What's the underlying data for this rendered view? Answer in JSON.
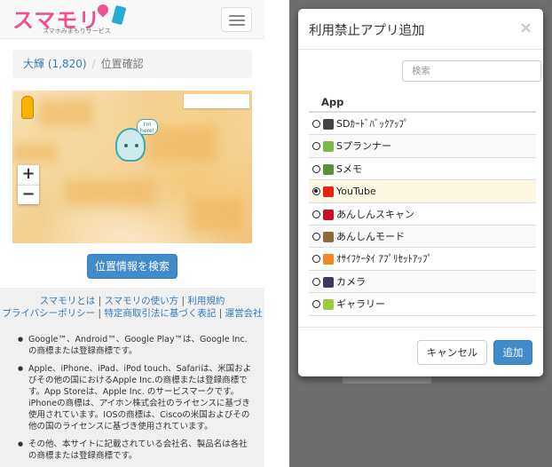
{
  "left": {
    "logo": {
      "text": "スマモリ",
      "subtitle": "スマホみまもりサービス"
    },
    "breadcrumb": {
      "link": "大輝 (1,820)",
      "separator": "/",
      "current": "位置確認"
    },
    "map": {
      "marker_text": "I'm here!"
    },
    "search_button": "位置情報を検索",
    "footer": {
      "links": [
        "スマモリとは",
        "スマモリの使い方",
        "利用規約",
        "プライバシーポリシー",
        "特定商取引法に基づく表記",
        "運営会社"
      ],
      "notes": [
        "Google™、Android™、Google Play™は、Google Inc.の商標または登録商標です。",
        "Apple、iPhone、iPad、iPod touch、Safariは、米国およびその他の国におけるApple Inc.の商標または登録商標です。App Storeは、Apple Inc. のサービスマークです。iPhoneの商標は、アイホン株式会社のライセンスに基づき使用されています。IOSの商標は、Ciscoの米国およびその他の国のライセンスに基づき使用されています。",
        "その他、本サイトに記載されている会社名、製品名は各社の商標または登録商標です。"
      ]
    }
  },
  "modal": {
    "title": "利用禁止アプリ追加",
    "close": "×",
    "search_placeholder": "検索",
    "column_header": "App",
    "apps": [
      {
        "name": "SDｶｰﾄﾞﾊﾞｯｸｱｯﾌﾟ",
        "checked": false,
        "icon_color": "#444444"
      },
      {
        "name": "Sプランナー",
        "checked": false,
        "icon_color": "#7db84a"
      },
      {
        "name": "Sメモ",
        "checked": false,
        "icon_color": "#5a8f3c"
      },
      {
        "name": "YouTube",
        "checked": true,
        "icon_color": "#e62117"
      },
      {
        "name": "あんしんスキャン",
        "checked": false,
        "icon_color": "#c8102e"
      },
      {
        "name": "あんしんモード",
        "checked": false,
        "icon_color": "#8b6b3e"
      },
      {
        "name": "ｵｻｲﾌｹｰﾀｲ ｱﾌﾟﾘｾｯﾄｱｯﾌﾟ",
        "checked": false,
        "icon_color": "#f08a24"
      },
      {
        "name": "カメラ",
        "checked": false,
        "icon_color": "#3a3a5a"
      },
      {
        "name": "ギャラリー",
        "checked": false,
        "icon_color": "#9bcb3c"
      }
    ],
    "cancel_label": "キャンセル",
    "add_label": "追加"
  }
}
